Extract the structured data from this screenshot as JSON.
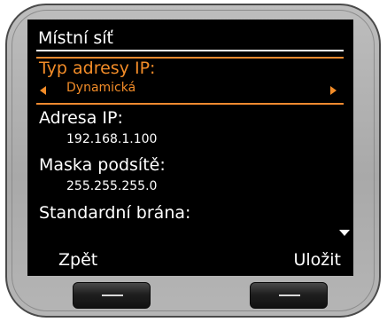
{
  "screen": {
    "title": "Místní síť"
  },
  "fields": [
    {
      "label": "Typ adresy IP:",
      "value": "Dynamická",
      "selected": true
    },
    {
      "label": "Adresa IP:",
      "value": "192.168.1.100"
    },
    {
      "label": "Maska podsítě:",
      "value": "255.255.255.0"
    },
    {
      "label": "Standardní brána:"
    }
  ],
  "softkeys": {
    "left": "Zpět",
    "right": "Uložit"
  },
  "colors": {
    "highlight": "#f28c28",
    "screen_bg": "#000000",
    "text": "#ffffff",
    "bezel": "#b0b0b0"
  },
  "icons": {
    "left_arrow": "triangle-left-icon",
    "right_arrow": "triangle-right-icon",
    "scroll": "scroll-down-icon"
  }
}
